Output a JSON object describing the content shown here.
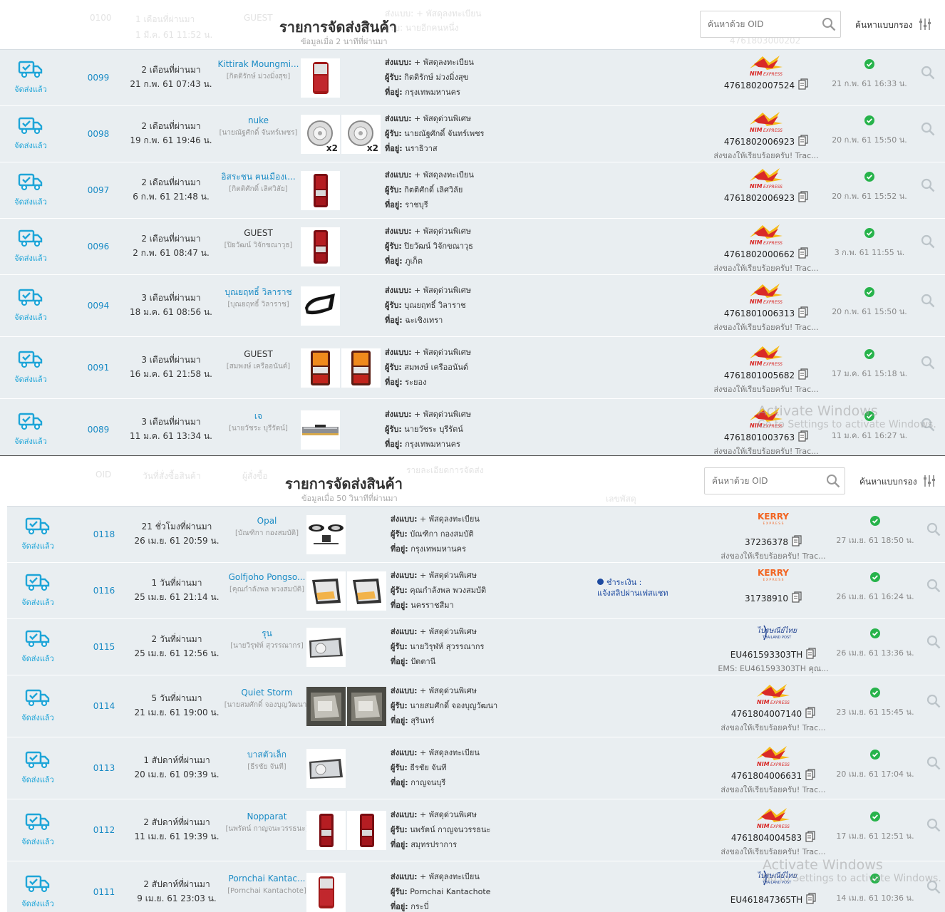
{
  "panels": [
    {
      "header": {
        "title": "รายการจัดส่งสินค้า",
        "updated": "ข้อมูลเมื่อ 2 นาทีที่ผ่านมา",
        "search_placeholder": "ค้นหาด้วย OID",
        "advanced_label": "ค้นหาแบบกรอง",
        "ghost": {
          "oid": "0100",
          "date1": "1 เดือนที่ผ่านมา",
          "date2": "1 มี.ค. 61 11:52 น.",
          "cust": "GUEST",
          "ship": "ส่งแบบ: + พัสดุลงทะเบียน",
          "recv": "ผู้รับ: นายอีกคนหนึ่ง",
          "track": "4761803000202"
        }
      },
      "rows": [
        {
          "status": "จัดส่งแล้ว",
          "oid": "0099",
          "ago": "2 เดือนที่ผ่านมา",
          "date": "21 ก.พ. 61 07:43 น.",
          "customer": "Kittirak Moungmi...",
          "customer_link": true,
          "receiver_sub": "[กิตติรักษ์ ม่วงมิ่งสุข]",
          "thumbs": [
            {
              "kind": "taillight",
              "qty": ""
            }
          ],
          "ship_label": "ส่งแบบ:",
          "ship": "+ พัสดุลงทะเบียน",
          "recv_label": "ผู้รับ:",
          "recv": "กิตติรักษ์ ม่วงมิ่งสุข",
          "addr_label": "ที่อยู่:",
          "addr": "กรุงเทพมหานคร",
          "payment": "",
          "payment_note": "",
          "carrier": "nim",
          "tracking": "4761802007524",
          "track_status": "",
          "delivered": "21 ก.พ. 61 16:33 น."
        },
        {
          "status": "จัดส่งแล้ว",
          "oid": "0098",
          "ago": "2 เดือนที่ผ่านมา",
          "date": "19 ก.พ. 61 19:46 น.",
          "customer": "nuke",
          "customer_link": true,
          "receiver_sub": "[นายณัฐศักดิ์ จันทร์เพชร]",
          "thumbs": [
            {
              "kind": "headlamp",
              "qty": "x2"
            },
            {
              "kind": "headlamp",
              "qty": "x2"
            }
          ],
          "ship_label": "ส่งแบบ:",
          "ship": "+ พัสดุด่วนพิเศษ",
          "recv_label": "ผู้รับ:",
          "recv": "นายณัฐศักดิ์ จันทร์เพชร",
          "addr_label": "ที่อยู่:",
          "addr": "นราธิวาส",
          "payment": "",
          "payment_note": "",
          "carrier": "nim",
          "tracking": "4761802006923",
          "track_status": "ส่งของให้เรียบร้อยครับ! Trac...",
          "delivered": "20 ก.พ. 61 15:50 น."
        },
        {
          "status": "จัดส่งแล้ว",
          "oid": "0097",
          "ago": "2 เดือนที่ผ่านมา",
          "date": "6 ก.พ. 61 21:48 น.",
          "customer": "อิสระชน ฅนเมืองเ...",
          "customer_link": true,
          "receiver_sub": "[กิตติศักดิ์ เลิศวิลัย]",
          "thumbs": [
            {
              "kind": "taillight2",
              "qty": ""
            }
          ],
          "ship_label": "ส่งแบบ:",
          "ship": "+ พัสดุลงทะเบียน",
          "recv_label": "ผู้รับ:",
          "recv": "กิตติศักดิ์ เลิศวิลัย",
          "addr_label": "ที่อยู่:",
          "addr": "ราชบุรี",
          "payment": "",
          "payment_note": "",
          "carrier": "nim",
          "tracking": "4761802006923",
          "track_status": "",
          "delivered": "20 ก.พ. 61 15:52 น."
        },
        {
          "status": "จัดส่งแล้ว",
          "oid": "0096",
          "ago": "2 เดือนที่ผ่านมา",
          "date": "2 ก.พ. 61 08:47 น.",
          "customer": "GUEST",
          "customer_link": false,
          "receiver_sub": "[ปิยวัฒน์ วิจักขณาวุธ]",
          "thumbs": [
            {
              "kind": "taillight2",
              "qty": ""
            }
          ],
          "ship_label": "ส่งแบบ:",
          "ship": "+ พัสดุด่วนพิเศษ",
          "recv_label": "ผู้รับ:",
          "recv": "ปิยวัฒน์ วิจักขณาวุธ",
          "addr_label": "ที่อยู่:",
          "addr": "ภูเก็ต",
          "payment": "",
          "payment_note": "",
          "carrier": "nim",
          "tracking": "4761802000662",
          "track_status": "ส่งของให้เรียบร้อยครับ! Trac...",
          "delivered": "3 ก.พ. 61 11:55 น."
        },
        {
          "status": "จัดส่งแล้ว",
          "oid": "0094",
          "ago": "3 เดือนที่ผ่านมา",
          "date": "18 ม.ค. 61 08:56 น.",
          "customer": "บุณยฤทธิ์ วิลาราช",
          "customer_link": true,
          "receiver_sub": "[บุณยฤทธิ์ วิลาราช]",
          "thumbs": [
            {
              "kind": "mirror",
              "qty": ""
            }
          ],
          "ship_label": "ส่งแบบ:",
          "ship": "+ พัสดุด่วนพิเศษ",
          "recv_label": "ผู้รับ:",
          "recv": "บุณยฤทธิ์ วิลาราช",
          "addr_label": "ที่อยู่:",
          "addr": "ฉะเชิงเทรา",
          "payment": "",
          "payment_note": "",
          "carrier": "nim",
          "tracking": "4761801006313",
          "track_status": "ส่งของให้เรียบร้อยครับ! Trac...",
          "delivered": "20 ก.พ. 61 15:50 น."
        },
        {
          "status": "จัดส่งแล้ว",
          "oid": "0091",
          "ago": "3 เดือนที่ผ่านมา",
          "date": "16 ม.ค. 61 21:58 น.",
          "customer": "GUEST",
          "customer_link": false,
          "receiver_sub": "[สมพงษ์ เครืออนันต์]",
          "thumbs": [
            {
              "kind": "amber",
              "qty": ""
            },
            {
              "kind": "amber",
              "qty": ""
            }
          ],
          "ship_label": "ส่งแบบ:",
          "ship": "+ พัสดุด่วนพิเศษ",
          "recv_label": "ผู้รับ:",
          "recv": "สมพงษ์ เครืออนันต์",
          "addr_label": "ที่อยู่:",
          "addr": "ระยอง",
          "payment": "",
          "payment_note": "",
          "carrier": "nim",
          "tracking": "4761801005682",
          "track_status": "ส่งของให้เรียบร้อยครับ! Trac...",
          "delivered": "17 ม.ค. 61 15:18 น."
        },
        {
          "status": "จัดส่งแล้ว",
          "oid": "0089",
          "ago": "3 เดือนที่ผ่านมา",
          "date": "11 ม.ค. 61 13:34 น.",
          "customer": "เจ",
          "customer_link": true,
          "receiver_sub": "[นายวัชระ บุรีรัตน์]",
          "thumbs": [
            {
              "kind": "bumper",
              "qty": ""
            }
          ],
          "ship_label": "ส่งแบบ:",
          "ship": "+ พัสดุด่วนพิเศษ",
          "recv_label": "ผู้รับ:",
          "recv": "นายวัชระ บุรีรัตน์",
          "addr_label": "ที่อยู่:",
          "addr": "กรุงเทพมหานคร",
          "payment": "",
          "payment_note": "",
          "carrier": "nim",
          "tracking": "4761801003763",
          "track_status": "ส่งของให้เรียบร้อยครับ! Trac...",
          "delivered": "11 ม.ค. 61 16:27 น."
        }
      ],
      "watermark": {
        "line1": "Activate Windows",
        "line2": "Go to Settings to activate Windows."
      }
    },
    {
      "header": {
        "title": "รายการจัดส่งสินค้า",
        "updated": "ข้อมูลเมื่อ 50 วินาทีที่ผ่านมา",
        "search_placeholder": "ค้นหาด้วย OID",
        "advanced_label": "ค้นหาแบบกรอง",
        "ghost": {
          "oid": "OID",
          "date1": "วันที่สั่งซื้อสินค้า",
          "date2": "",
          "cust": "ผู้สั่งซื้อ",
          "ship": "รายละเอียดการจัดส่ง",
          "recv": "",
          "track": "เลขพัสดุ"
        }
      },
      "rows": [
        {
          "status": "จัดส่งแล้ว",
          "oid": "0118",
          "ago": "21 ชั่วโมงที่ผ่านมา",
          "date": "26 เม.ย. 61 20:59 น.",
          "customer": "Opal",
          "customer_link": true,
          "receiver_sub": "[บัณฑิกา กองสมบัติ]",
          "thumbs": [
            {
              "kind": "fog",
              "qty": ""
            }
          ],
          "ship_label": "ส่งแบบ:",
          "ship": "+ พัสดุลงทะเบียน",
          "recv_label": "ผู้รับ:",
          "recv": "บัณฑิกา กองสมบัติ",
          "addr_label": "ที่อยู่:",
          "addr": "กรุงเทพมหานคร",
          "payment": "",
          "payment_note": "",
          "carrier": "kerry",
          "tracking": "37236378",
          "track_status": "ส่งของให้เรียบร้อยครับ! Trac...",
          "delivered": "27 เม.ย. 61 18:50 น."
        },
        {
          "status": "จัดส่งแล้ว",
          "oid": "0116",
          "ago": "1 วันที่ผ่านมา",
          "date": "25 เม.ย. 61 21:14 น.",
          "customer": "Golfjoho Pongso...",
          "customer_link": true,
          "receiver_sub": "[คุณกำลังพล พวงสมบัติ]",
          "thumbs": [
            {
              "kind": "corner",
              "qty": ""
            },
            {
              "kind": "corner",
              "qty": ""
            }
          ],
          "ship_label": "ส่งแบบ:",
          "ship": "+ พัสดุด่วนพิเศษ",
          "recv_label": "ผู้รับ:",
          "recv": "คุณกำลังพล พวงสมบัติ",
          "addr_label": "ที่อยู่:",
          "addr": "นครราชสีมา",
          "payment": "ชำระเงิน :",
          "payment_note": "แจ้งสลิปผ่านเฟสแชท",
          "carrier": "kerry",
          "tracking": "31738910",
          "track_status": "",
          "delivered": "26 เม.ย. 61 16:24 น."
        },
        {
          "status": "จัดส่งแล้ว",
          "oid": "0115",
          "ago": "2 วันที่ผ่านมา",
          "date": "25 เม.ย. 61 12:56 น.",
          "customer": "รุน",
          "customer_link": true,
          "receiver_sub": "[นายวิรุฬห์ สุวรรณากร]",
          "thumbs": [
            {
              "kind": "headlight",
              "qty": ""
            }
          ],
          "ship_label": "ส่งแบบ:",
          "ship": "+ พัสดุด่วนพิเศษ",
          "recv_label": "ผู้รับ:",
          "recv": "นายวิรุฬห์ สุวรรณากร",
          "addr_label": "ที่อยู่:",
          "addr": "ปัตตานี",
          "payment": "",
          "payment_note": "",
          "carrier": "thaipost",
          "tracking": "EU461593303TH",
          "track_status": "EMS: EU461593303TH คุณ...",
          "delivered": "26 เม.ย. 61 13:36 น."
        },
        {
          "status": "จัดส่งแล้ว",
          "oid": "0114",
          "ago": "5 วันที่ผ่านมา",
          "date": "21 เม.ย. 61 19:00 น.",
          "customer": "Quiet Storm",
          "customer_link": true,
          "receiver_sub": "[นายสมศักดิ์ จองบุญวัฒนา]",
          "thumbs": [
            {
              "kind": "photo",
              "qty": ""
            },
            {
              "kind": "photo",
              "qty": ""
            }
          ],
          "ship_label": "ส่งแบบ:",
          "ship": "+ พัสดุด่วนพิเศษ",
          "recv_label": "ผู้รับ:",
          "recv": "นายสมศักดิ์ จองบุญวัฒนา",
          "addr_label": "ที่อยู่:",
          "addr": "สุรินทร์",
          "payment": "",
          "payment_note": "",
          "carrier": "nim",
          "tracking": "4761804007140",
          "track_status": "ส่งของให้เรียบร้อยครับ! Trac...",
          "delivered": "23 เม.ย. 61 15:45 น."
        },
        {
          "status": "จัดส่งแล้ว",
          "oid": "0113",
          "ago": "1 สัปดาห์ที่ผ่านมา",
          "date": "20 เม.ย. 61 09:39 น.",
          "customer": "บาสตัวเล็ก",
          "customer_link": true,
          "receiver_sub": "[ธีรชัย จันที]",
          "thumbs": [
            {
              "kind": "headlight",
              "qty": ""
            }
          ],
          "ship_label": "ส่งแบบ:",
          "ship": "+ พัสดุลงทะเบียน",
          "recv_label": "ผู้รับ:",
          "recv": "ธีรชัย จันที",
          "addr_label": "ที่อยู่:",
          "addr": "กาญจนบุรี",
          "payment": "",
          "payment_note": "",
          "carrier": "nim",
          "tracking": "4761804006631",
          "track_status": "ส่งของให้เรียบร้อยครับ! Trac...",
          "delivered": "20 เม.ย. 61 17:04 น."
        },
        {
          "status": "จัดส่งแล้ว",
          "oid": "0112",
          "ago": "2 สัปดาห์ที่ผ่านมา",
          "date": "11 เม.ย. 61 19:39 น.",
          "customer": "Nopparat",
          "customer_link": true,
          "receiver_sub": "[นพรัตน์ กาญจนะวรรธนะ]",
          "thumbs": [
            {
              "kind": "taillight2",
              "qty": ""
            },
            {
              "kind": "taillight2",
              "qty": ""
            }
          ],
          "ship_label": "ส่งแบบ:",
          "ship": "+ พัสดุด่วนพิเศษ",
          "recv_label": "ผู้รับ:",
          "recv": "นพรัตน์ กาญจนวรรธนะ",
          "addr_label": "ที่อยู่:",
          "addr": "สมุทรปราการ",
          "payment": "",
          "payment_note": "",
          "carrier": "nim",
          "tracking": "4761804004583",
          "track_status": "ส่งของให้เรียบร้อยครับ! Trac...",
          "delivered": "17 เม.ย. 61 12:51 น."
        },
        {
          "status": "จัดส่งแล้ว",
          "oid": "0111",
          "ago": "2 สัปดาห์ที่ผ่านมา",
          "date": "9 เม.ย. 61 23:03 น.",
          "customer": "Pornchai Kantac...",
          "customer_link": true,
          "receiver_sub": "[Pornchai Kantachote]",
          "thumbs": [
            {
              "kind": "taillight",
              "qty": ""
            }
          ],
          "ship_label": "ส่งแบบ:",
          "ship": "+ พัสดุลงทะเบียน",
          "recv_label": "ผู้รับ:",
          "recv": "Pornchai Kantachote",
          "addr_label": "ที่อยู่:",
          "addr": "กระบี่",
          "payment": "",
          "payment_note": "",
          "carrier": "thaipost",
          "tracking": "EU461847365TH",
          "track_status": "",
          "delivered": "14 เม.ย. 61 10:36 น."
        }
      ],
      "watermark": {
        "line1": "Activate Windows",
        "line2": "Go to Settings to activate Windows."
      }
    }
  ],
  "colors": {
    "accent": "#1ea5d8",
    "link": "#1a8bc5",
    "success": "#27b34b",
    "row_bg": "#e9eef1",
    "nim_red": "#d92a27",
    "nim_yellow": "#f7b500",
    "kerry_orange": "#f26522",
    "thaipost_blue": "#1d3f8f"
  },
  "icons": {
    "status": "delivery-truck-icon",
    "search": "search-icon",
    "filter": "sliders-icon",
    "copy": "copy-icon",
    "check": "check-circle-icon",
    "magnifier": "magnifier-icon"
  }
}
